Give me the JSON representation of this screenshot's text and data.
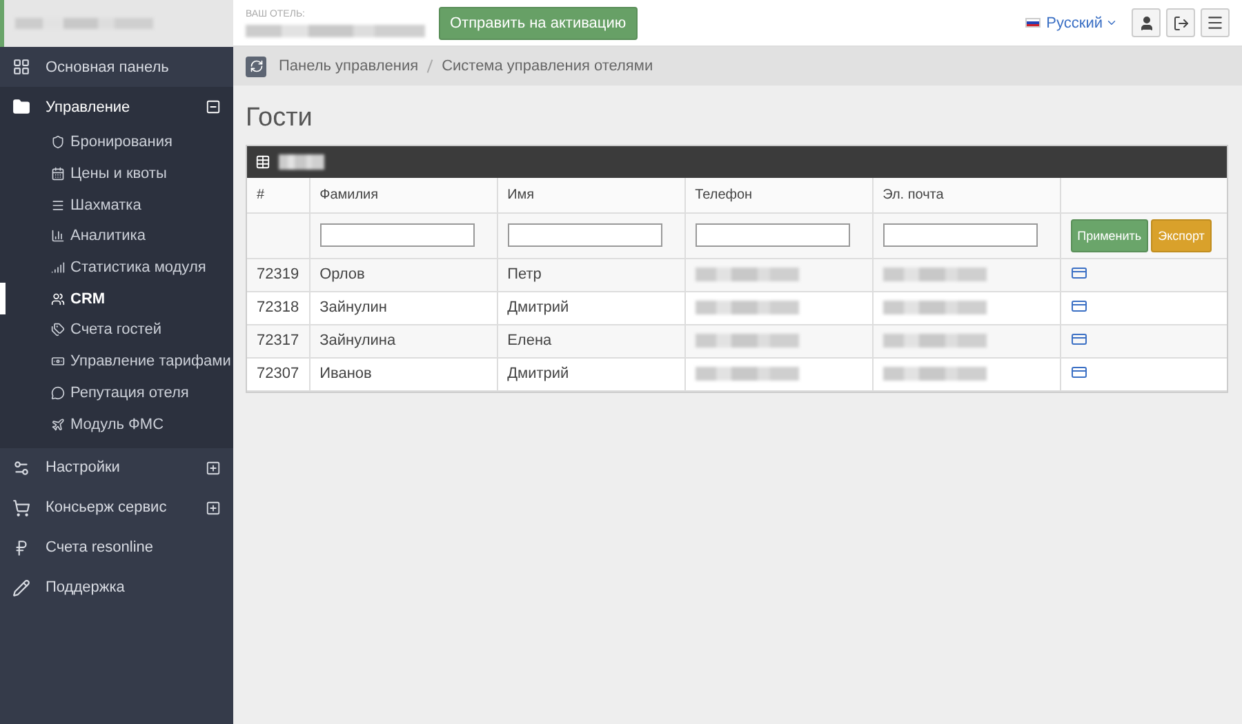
{
  "top_bar": {
    "hotel_label": "ВАШ ОТЕЛЬ:",
    "activate_button": "Отправить на активацию",
    "language": "Русский"
  },
  "sidebar": {
    "items": [
      {
        "label": "Основная панель"
      },
      {
        "label": "Управление",
        "expanded": true,
        "children": [
          {
            "label": "Бронирования",
            "selected": false
          },
          {
            "label": "Цены и квоты",
            "selected": false
          },
          {
            "label": "Шахматка",
            "selected": false
          },
          {
            "label": "Аналитика",
            "selected": false
          },
          {
            "label": "Статистика модуля",
            "selected": false
          },
          {
            "label": "CRM",
            "selected": true
          },
          {
            "label": "Счета гостей",
            "selected": false
          },
          {
            "label": "Управление тарифами",
            "selected": false
          },
          {
            "label": "Репутация отеля",
            "selected": false
          },
          {
            "label": "Модуль ФМС",
            "selected": false
          }
        ]
      },
      {
        "label": "Настройки",
        "expanded": false
      },
      {
        "label": "Консьерж сервис",
        "expanded": false
      },
      {
        "label": "Счета resonline"
      },
      {
        "label": "Поддержка"
      }
    ]
  },
  "breadcrumb": [
    "Панель управления",
    "Система управления отелями"
  ],
  "page_title": "Гости",
  "table": {
    "columns": [
      "#",
      "Фамилия",
      "Имя",
      "Телефон",
      "Эл. почта"
    ],
    "filter_buttons": [
      {
        "label": "Применить",
        "kind": "apply"
      },
      {
        "label": "Экспорт",
        "kind": "export"
      }
    ],
    "rows": [
      {
        "id": "72319",
        "last_name": "Орлов",
        "first_name": "Петр"
      },
      {
        "id": "72318",
        "last_name": "Зайнулин",
        "first_name": "Дмитрий"
      },
      {
        "id": "72317",
        "last_name": "Зайнулина",
        "first_name": "Елена"
      },
      {
        "id": "72307",
        "last_name": "Иванов",
        "first_name": "Дмитрий"
      }
    ]
  }
}
